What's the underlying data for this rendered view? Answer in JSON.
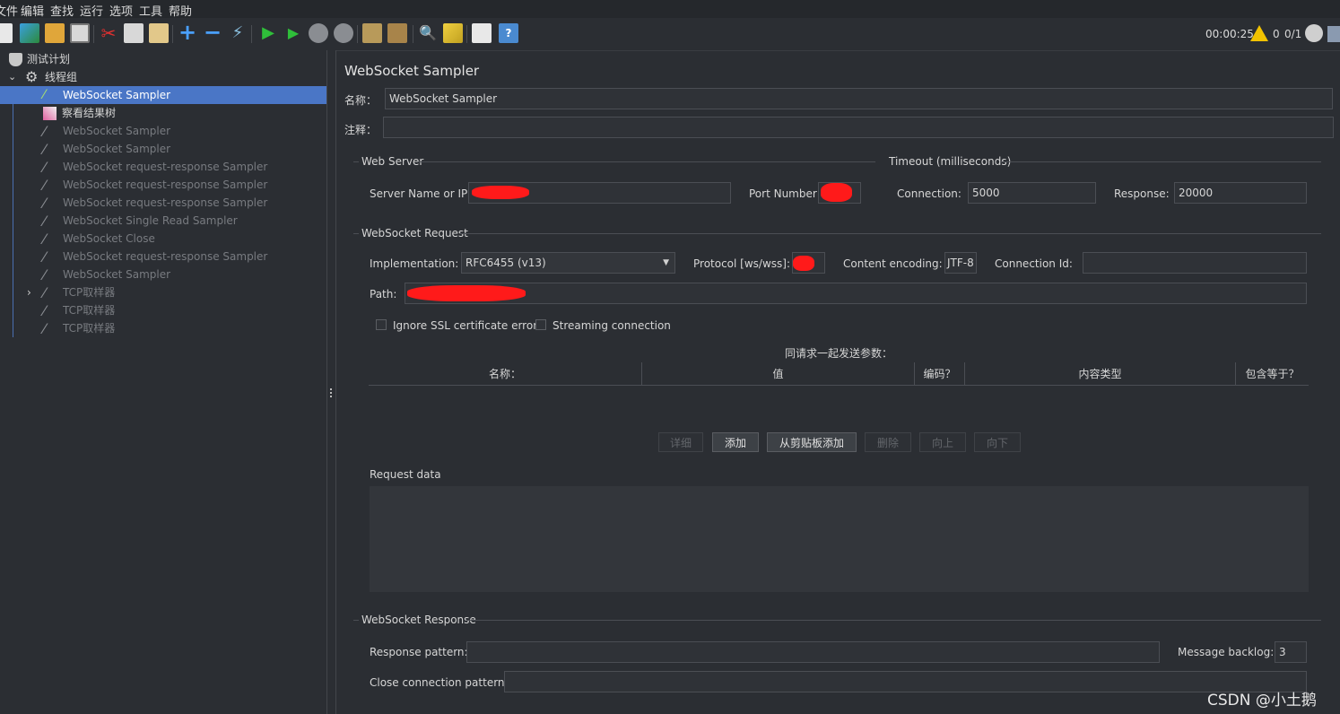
{
  "menu": [
    "文件",
    "编辑",
    "查找",
    "运行",
    "选项",
    "工具",
    "帮助"
  ],
  "toolbar": {
    "timer": "00:00:25",
    "warning_count": "0",
    "threads": "0/1"
  },
  "tree": {
    "items": [
      {
        "label": "测试计划",
        "icon": "test-plan-icon"
      },
      {
        "label": "线程组",
        "icon": "gear-icon"
      },
      {
        "label": "WebSocket Sampler",
        "icon": "pipette-icon"
      },
      {
        "label": "察看结果树",
        "icon": "chart-icon"
      },
      {
        "label": "WebSocket Sampler",
        "icon": "pipette-icon"
      },
      {
        "label": "WebSocket Sampler",
        "icon": "pipette-icon"
      },
      {
        "label": "WebSocket request-response Sampler",
        "icon": "pipette-icon"
      },
      {
        "label": "WebSocket request-response Sampler",
        "icon": "pipette-icon"
      },
      {
        "label": "WebSocket request-response Sampler",
        "icon": "pipette-icon"
      },
      {
        "label": "WebSocket Single Read Sampler",
        "icon": "pipette-icon"
      },
      {
        "label": "WebSocket Close",
        "icon": "pipette-icon"
      },
      {
        "label": "WebSocket request-response Sampler",
        "icon": "pipette-icon"
      },
      {
        "label": "WebSocket Sampler",
        "icon": "pipette-icon"
      },
      {
        "label": "TCP取样器",
        "icon": "pipette-icon"
      },
      {
        "label": "TCP取样器",
        "icon": "pipette-icon"
      },
      {
        "label": "TCP取样器",
        "icon": "pipette-icon"
      }
    ]
  },
  "panel": {
    "title": "WebSocket Sampler",
    "name_label": "名称：",
    "name_value": "WebSocket Sampler",
    "comment_label": "注释：",
    "comment_value": "",
    "web_server": {
      "section": "Web Server",
      "server_label": "Server Name or IP:",
      "port_label": "Port Number:"
    },
    "timeout": {
      "section": "Timeout (milliseconds)",
      "connection_label": "Connection:",
      "connection_value": "5000",
      "response_label": "Response:",
      "response_value": "20000"
    },
    "request": {
      "section": "WebSocket Request",
      "implementation_label": "Implementation:",
      "implementation_value": "RFC6455 (v13)",
      "protocol_label": "Protocol [ws/wss]:",
      "encoding_label": "Content encoding:",
      "encoding_value": "JTF-8",
      "connection_id_label": "Connection Id:",
      "connection_id_value": "",
      "path_label": "Path:",
      "ignore_ssl_label": "Ignore SSL certificate errors",
      "streaming_label": "Streaming connection",
      "params_title": "同请求一起发送参数：",
      "columns": [
        "名称：",
        "值",
        "编码？",
        "内容类型",
        "包含等于？"
      ],
      "buttons": [
        "详细",
        "添加",
        "从剪贴板添加",
        "删除",
        "向上",
        "向下"
      ],
      "request_data_label": "Request data"
    },
    "response": {
      "section": "WebSocket Response",
      "pattern_label": "Response pattern:",
      "pattern_value": "",
      "backlog_label": "Message backlog:",
      "backlog_value": "3",
      "close_label": "Close connection pattern:",
      "close_value": ""
    }
  },
  "watermark": "CSDN @小土鹅",
  "colors": {
    "selection": "#4a76c6",
    "background": "#2b2e33",
    "redaction": "#ff1a1a"
  }
}
